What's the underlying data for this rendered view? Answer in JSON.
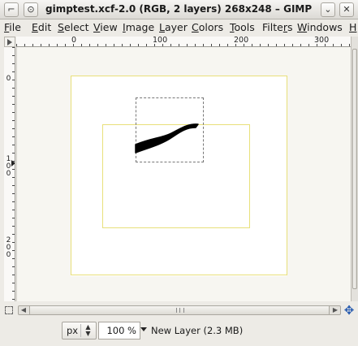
{
  "window": {
    "title": "gimptest.xcf-2.0 (RGB, 2 layers) 268x248 – GIMP",
    "menu_button": "⌐",
    "stick_button": "⊙",
    "minimize_button": "⌄",
    "close_button": "✕"
  },
  "menubar": {
    "items": [
      {
        "underlined": "F",
        "rest": "ile"
      },
      {
        "underlined": "E",
        "rest": "dit"
      },
      {
        "underlined": "S",
        "rest": "elect"
      },
      {
        "underlined": "V",
        "rest": "iew"
      },
      {
        "underlined": "I",
        "rest": "mage"
      },
      {
        "underlined": "L",
        "rest": "ayer"
      },
      {
        "underlined": "C",
        "rest": "olors"
      },
      {
        "underlined": "T",
        "rest": "ools"
      },
      {
        "underlined": "r",
        "rest": "Filte",
        "prefix_first": true
      },
      {
        "underlined": "W",
        "rest": "indows"
      },
      {
        "underlined": "H",
        "rest": ""
      }
    ]
  },
  "ruler": {
    "horizontal_labels": [
      "0",
      "100",
      "200",
      "300"
    ],
    "vertical_labels": [
      "0",
      "100",
      "200"
    ]
  },
  "statusbar": {
    "unit": "px",
    "zoom": "100 %",
    "layer_info": "New Layer (2.3 MB)"
  },
  "colors": {
    "selection_border": "#e8e07a",
    "stroke": "#000000",
    "canvas_bg": "#f7f6f1",
    "navigate_icon": "#2a5db0"
  }
}
